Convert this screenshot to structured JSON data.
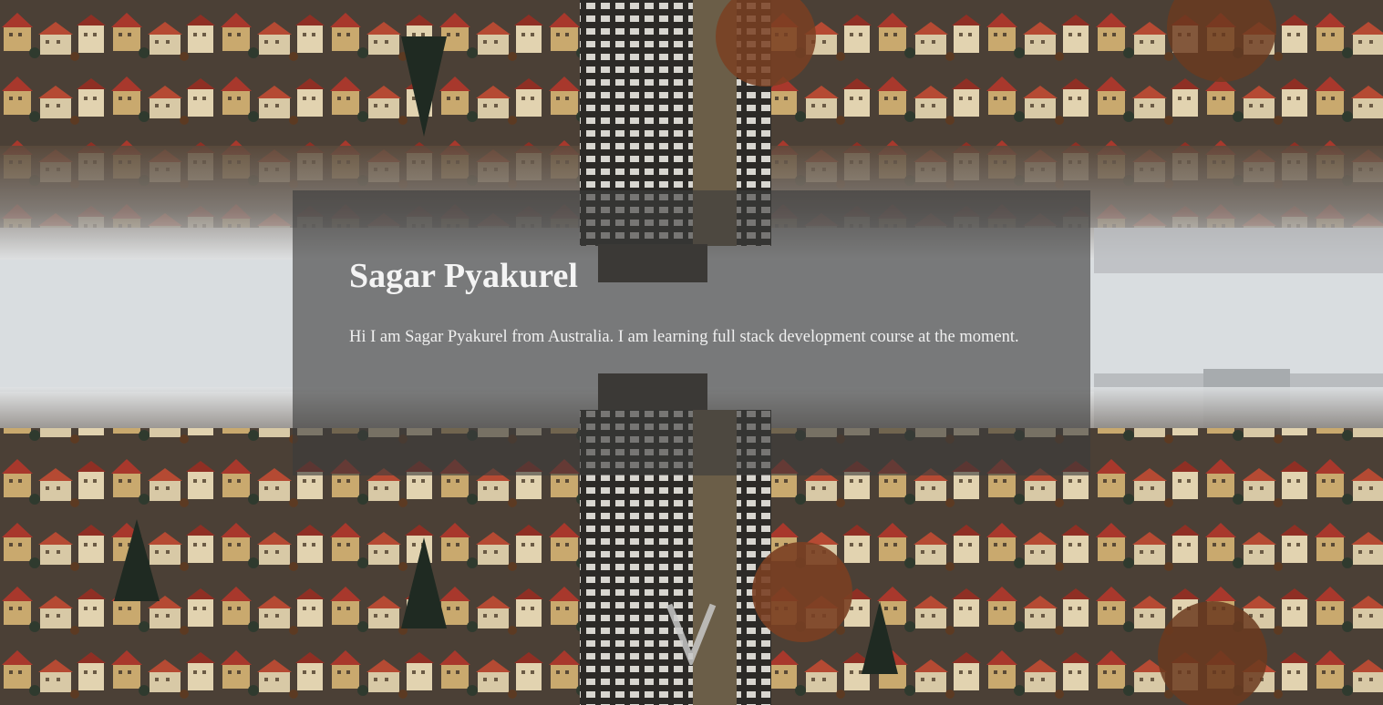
{
  "profile": {
    "name": "Sagar Pyakurel",
    "bio": "Hi I am Sagar Pyakurel from Australia. I am learning full stack development course at the moment."
  },
  "scroll_indicator": {
    "icon": "chevron-down-icon",
    "glyph": "V"
  },
  "colors": {
    "card_background": "#3c3c3c",
    "text": "#ffffff",
    "sky": "#d9dde0",
    "roof_red": "#a8382c",
    "wall_beige": "#c9a96e",
    "tower": "#3a352f"
  }
}
